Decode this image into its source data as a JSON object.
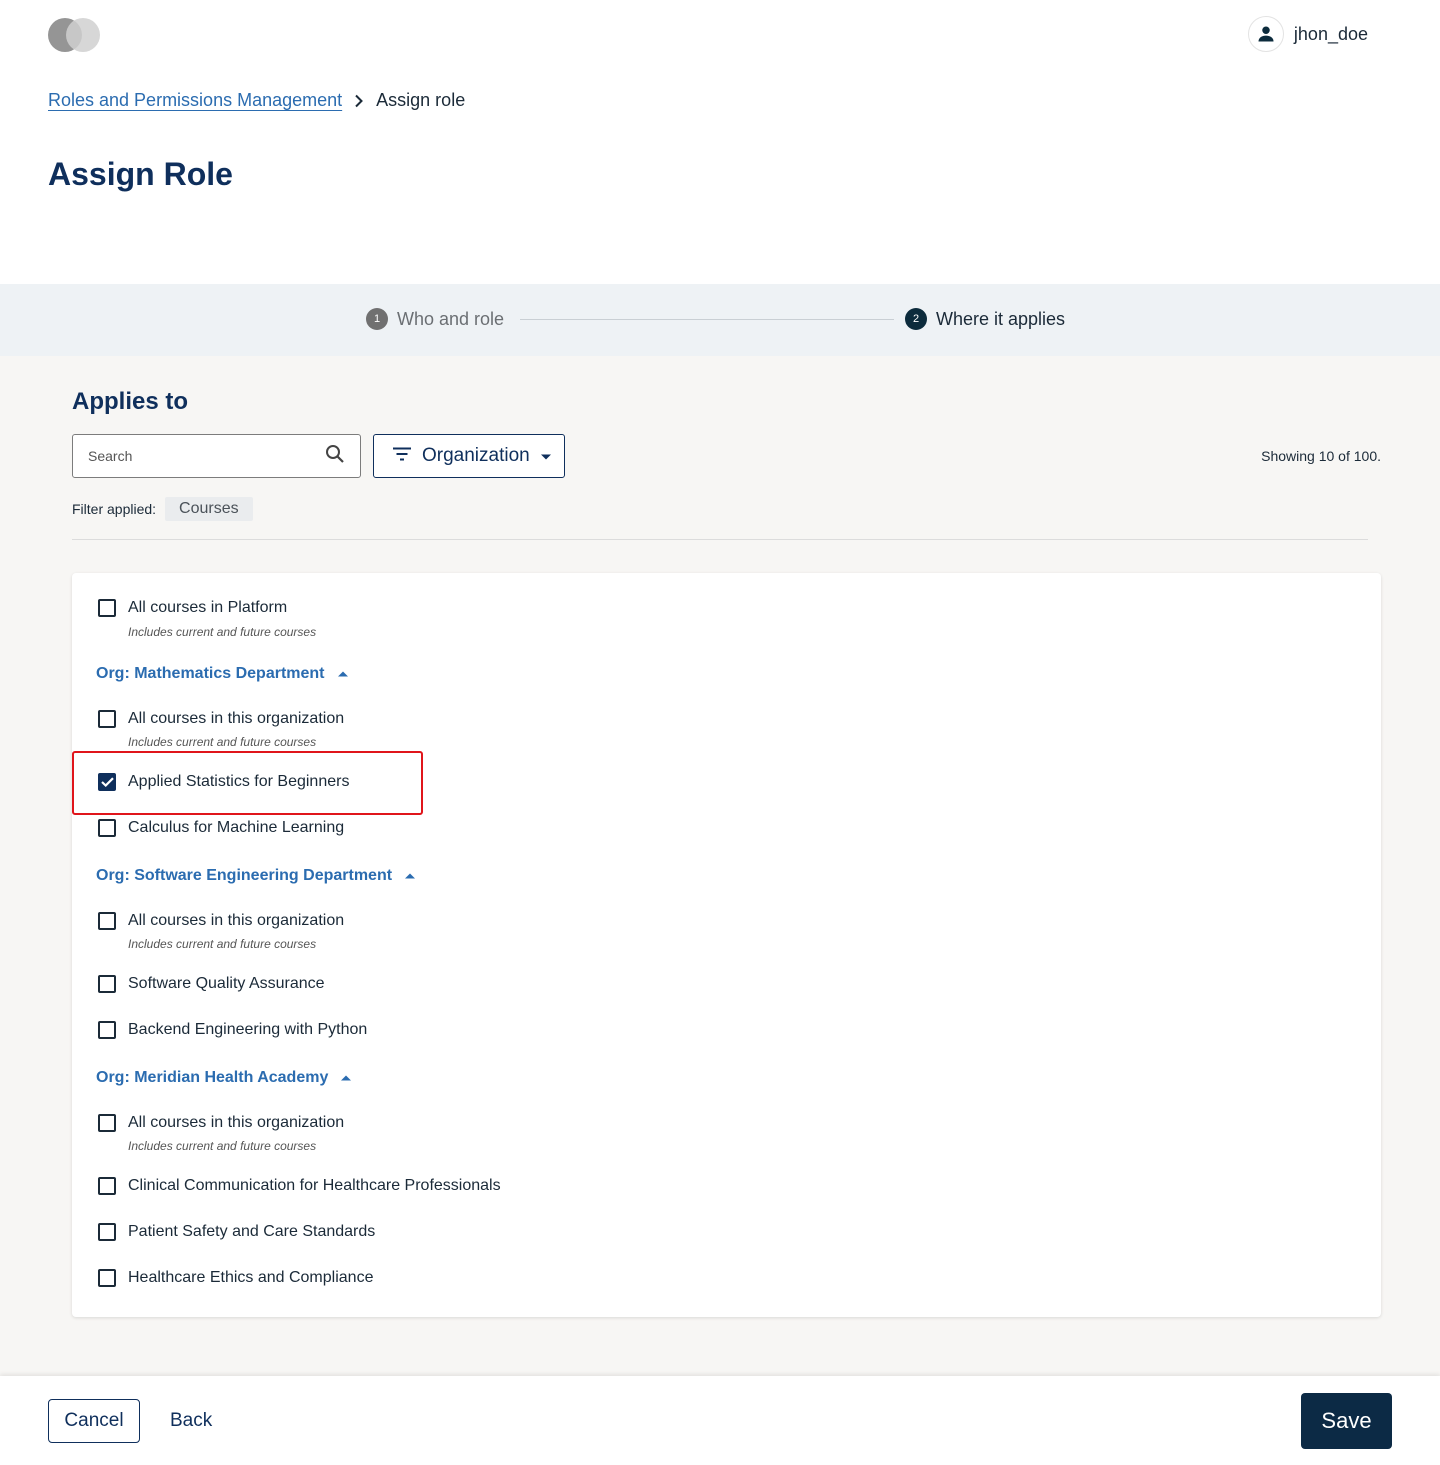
{
  "header": {
    "username": "jhon_doe"
  },
  "breadcrumb": {
    "parent": "Roles and Permissions Management",
    "current": "Assign role"
  },
  "page_title": "Assign Role",
  "stepper": {
    "steps": [
      {
        "number": "1",
        "label": "Who and role",
        "state": "completed"
      },
      {
        "number": "2",
        "label": "Where it applies",
        "state": "active"
      }
    ]
  },
  "section_title": "Applies to",
  "search": {
    "placeholder": "Search",
    "value": ""
  },
  "filter_button": {
    "label": "Organization"
  },
  "showing": "Showing 10  of 100.",
  "filter_applied": {
    "label": "Filter applied:",
    "chip": "Courses"
  },
  "list": {
    "platform": {
      "label": "All courses in Platform",
      "subtext": "Includes current and future courses",
      "checked": false
    },
    "orgs": [
      {
        "name": "Org: Mathematics Department",
        "all": {
          "label": "All courses in this organization",
          "subtext": "Includes current and future courses",
          "checked": false
        },
        "courses": [
          {
            "label": "Applied Statistics for Beginners",
            "checked": true
          },
          {
            "label": "Calculus for Machine Learning",
            "checked": false
          }
        ]
      },
      {
        "name": "Org: Software Engineering Department",
        "all": {
          "label": "All courses in this organization",
          "subtext": "Includes current and future courses",
          "checked": false
        },
        "courses": [
          {
            "label": "Software Quality Assurance",
            "checked": false
          },
          {
            "label": "Backend Engineering with Python",
            "checked": false
          }
        ]
      },
      {
        "name": "Org: Meridian Health Academy",
        "all": {
          "label": "All courses in this organization",
          "subtext": "Includes current and future courses",
          "checked": false
        },
        "courses": [
          {
            "label": "Clinical Communication for Healthcare Professionals",
            "checked": false
          },
          {
            "label": "Patient Safety and Care Standards",
            "checked": false
          },
          {
            "label": "Healthcare Ethics and Compliance",
            "checked": false
          }
        ]
      }
    ]
  },
  "footer": {
    "cancel": "Cancel",
    "back": "Back",
    "save": "Save"
  },
  "colors": {
    "primary": "#0f2f5c",
    "link": "#2b6cb0",
    "highlight": "#e0151b"
  }
}
